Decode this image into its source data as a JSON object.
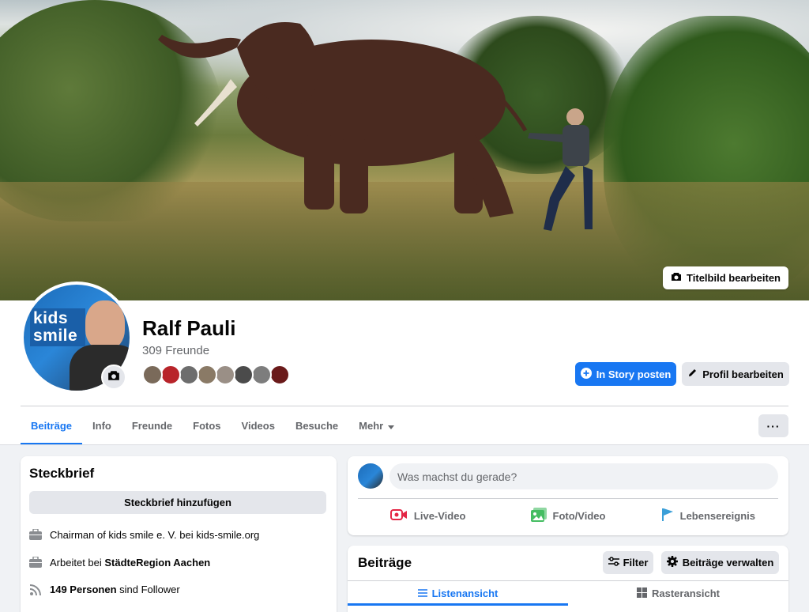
{
  "cover": {
    "edit_label": "Titelbild bearbeiten"
  },
  "profile": {
    "name": "Ralf Pauli",
    "friends_count": "309 Freunde",
    "avatar_text": "kids smile",
    "friend_avatar_colors": [
      "#7a6a5a",
      "#b8242a",
      "#6d6d6d",
      "#8a7a66",
      "#9a8f86",
      "#4b4b4b",
      "#7d7d7d",
      "#6a1a1a"
    ]
  },
  "actions": {
    "story_label": "In Story posten",
    "edit_profile_label": "Profil bearbeiten"
  },
  "tabs": [
    {
      "label": "Beiträge",
      "active": true
    },
    {
      "label": "Info"
    },
    {
      "label": "Freunde"
    },
    {
      "label": "Fotos"
    },
    {
      "label": "Videos"
    },
    {
      "label": "Besuche"
    },
    {
      "label": "Mehr"
    }
  ],
  "more_button": "···",
  "steckbrief": {
    "title": "Steckbrief",
    "add_label": "Steckbrief hinzufügen",
    "rows": [
      {
        "icon": "briefcase-icon",
        "text": "Chairman of kids smile e. V. bei kids-smile.org"
      },
      {
        "icon": "briefcase-icon",
        "prefix": "Arbeitet bei ",
        "bold": "StädteRegion Aachen"
      },
      {
        "icon": "rss-icon",
        "bold": "149 Personen",
        "suffix": " sind Follower"
      }
    ]
  },
  "composer": {
    "placeholder": "Was machst du gerade?",
    "live_label": "Live-Video",
    "photo_label": "Foto/Video",
    "event_label": "Lebensereignis"
  },
  "posts": {
    "title": "Beiträge",
    "filter_label": "Filter",
    "manage_label": "Beiträge verwalten",
    "list_view_label": "Listenansicht",
    "grid_view_label": "Rasteransicht"
  },
  "colors": {
    "accent": "#1877f2",
    "live_red": "#e42645",
    "photo_green": "#45bd62",
    "event_blue": "#3b9fd8"
  }
}
